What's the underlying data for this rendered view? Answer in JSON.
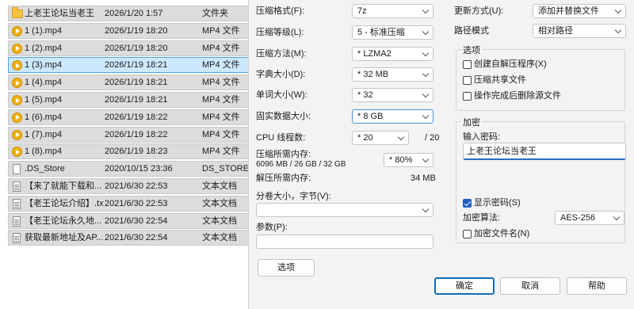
{
  "files": [
    {
      "name": "上老王论坛当老王",
      "date": "2026/1/20 1:57",
      "type": "文件夹",
      "icon": "folder-icon",
      "selected": false
    },
    {
      "name": "1 (1).mp4",
      "date": "2026/1/19 18:20",
      "type": "MP4 文件",
      "icon": "video-file-icon",
      "selected": false
    },
    {
      "name": "1 (2).mp4",
      "date": "2026/1/19 18:20",
      "type": "MP4 文件",
      "icon": "video-file-icon",
      "selected": false
    },
    {
      "name": "1 (3).mp4",
      "date": "2026/1/19 18:21",
      "type": "MP4 文件",
      "icon": "video-file-icon",
      "selected": true
    },
    {
      "name": "1 (4).mp4",
      "date": "2026/1/19 18:21",
      "type": "MP4 文件",
      "icon": "video-file-icon",
      "selected": false
    },
    {
      "name": "1 (5).mp4",
      "date": "2026/1/19 18:21",
      "type": "MP4 文件",
      "icon": "video-file-icon",
      "selected": false
    },
    {
      "name": "1 (6).mp4",
      "date": "2026/1/19 18:22",
      "type": "MP4 文件",
      "icon": "video-file-icon",
      "selected": false
    },
    {
      "name": "1 (7).mp4",
      "date": "2026/1/19 18:22",
      "type": "MP4 文件",
      "icon": "video-file-icon",
      "selected": false
    },
    {
      "name": "1 (8).mp4",
      "date": "2026/1/19 18:23",
      "type": "MP4 文件",
      "icon": "video-file-icon",
      "selected": false
    },
    {
      "name": ".DS_Store",
      "date": "2020/10/15 23:36",
      "type": "DS_STORE 文",
      "icon": "file-icon",
      "selected": false
    },
    {
      "name": "【来了就能下载和...",
      "date": "2021/6/30 22:53",
      "type": "文本文档",
      "icon": "text-file-icon",
      "selected": false
    },
    {
      "name": "【老王论坛介绍】.txt",
      "date": "2021/6/30 22:53",
      "type": "文本文档",
      "icon": "text-file-icon",
      "selected": false
    },
    {
      "name": "【老王论坛永久地...",
      "date": "2021/6/30 22:54",
      "type": "文本文档",
      "icon": "text-file-icon",
      "selected": false
    },
    {
      "name": "获取最新地址及AP...",
      "date": "2021/6/30 22:54",
      "type": "文本文档",
      "icon": "text-file-icon",
      "selected": false
    }
  ],
  "dialog": {
    "format_label": "压缩格式(F):",
    "format_value": "7z",
    "level_label": "压缩等级(L):",
    "level_value": "5 - 标准压缩",
    "method_label": "压缩方法(M):",
    "method_value": "* LZMA2",
    "dict_label": "字典大小(D):",
    "dict_value": "* 32 MB",
    "word_label": "单词大小(W):",
    "word_value": "* 32",
    "solid_label": "固实数据大小:",
    "solid_value": "* 8 GB",
    "cpu_label": "CPU 线程数:",
    "cpu_value": "* 20",
    "cpu_max": "/ 20",
    "mem_comp_label": "压缩所需内存:",
    "mem_comp_value": "6096 MB / 26 GB / 32 GB",
    "mem_percent": "* 80%",
    "mem_decomp_label": "解压所需内存:",
    "mem_decomp_value": "34 MB",
    "split_label": "分卷大小，字节(V):",
    "split_value": "",
    "params_label": "参数(P):",
    "params_value": "",
    "options_button": "选项",
    "update_label": "更新方式(U):",
    "update_value": "添加并替换文件",
    "path_label": "路径模式",
    "path_value": "相对路径",
    "options_group": "选项",
    "opt_sfx": "创建自解压程序(X)",
    "opt_shared": "压缩共享文件",
    "opt_delete": "操作完成后删除源文件",
    "encrypt_group": "加密",
    "password_label": "输入密码:",
    "password_value": "上老王论坛当老王",
    "show_password": "显示密码(S)",
    "encrypt_method_label": "加密算法:",
    "encrypt_method_value": "AES-256",
    "encrypt_names": "加密文件名(N)",
    "ok": "确定",
    "cancel": "取消",
    "help": "帮助"
  }
}
